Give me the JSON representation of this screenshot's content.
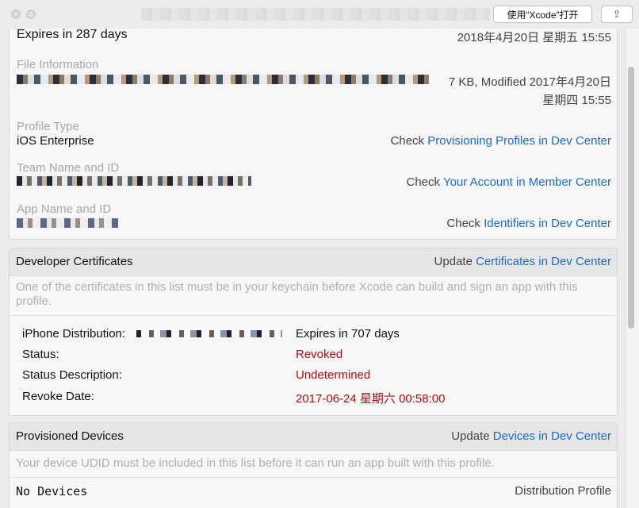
{
  "toolbar": {
    "open_with_xcode": "使用“Xcode”打开",
    "share_icon": "share-icon"
  },
  "profile": {
    "expires": "Expires in 287 days",
    "created_date": "2018年4月20日 星期五 15:55",
    "file_info_label": "File Information",
    "file_info_value_line1": "7 KB, Modified 2017年4月20日",
    "file_info_value_line2": "星期四 15:55",
    "profile_type_label": "Profile Type",
    "profile_type_value": "iOS Enterprise",
    "profile_type_check": "Check",
    "profile_type_link": "Provisioning Profiles in Dev Center",
    "team_label": "Team Name and ID",
    "team_check": "Check",
    "team_link": "Your Account in Member Center",
    "app_label": "App Name and ID",
    "app_check": "Check",
    "app_link": "Identifiers in Dev Center"
  },
  "certificates": {
    "title": "Developer Certificates",
    "update": "Update",
    "update_link": "Certificates in Dev Center",
    "note": "One of the certificates in this list must be in your keychain before Xcode can build and sign an app with this profile.",
    "cert_name_label": "iPhone Distribution:",
    "cert_expires": "Expires in 707 days",
    "status_label": "Status:",
    "status_value": "Revoked",
    "status_desc_label": "Status Description:",
    "status_desc_value": "Undetermined",
    "revoke_date_label": "Revoke Date:",
    "revoke_date_value": "2017-06-24 星期六 00:58:00"
  },
  "devices": {
    "title": "Provisioned Devices",
    "update": "Update",
    "update_link": "Devices in Dev Center",
    "note": "Your device UDID must be included in this list before it can run an app built with this profile.",
    "none": "No Devices",
    "profile_kind": "Distribution Profile"
  },
  "colors": {
    "link": "#1b6ac9",
    "revoked": "#b20e0e"
  }
}
